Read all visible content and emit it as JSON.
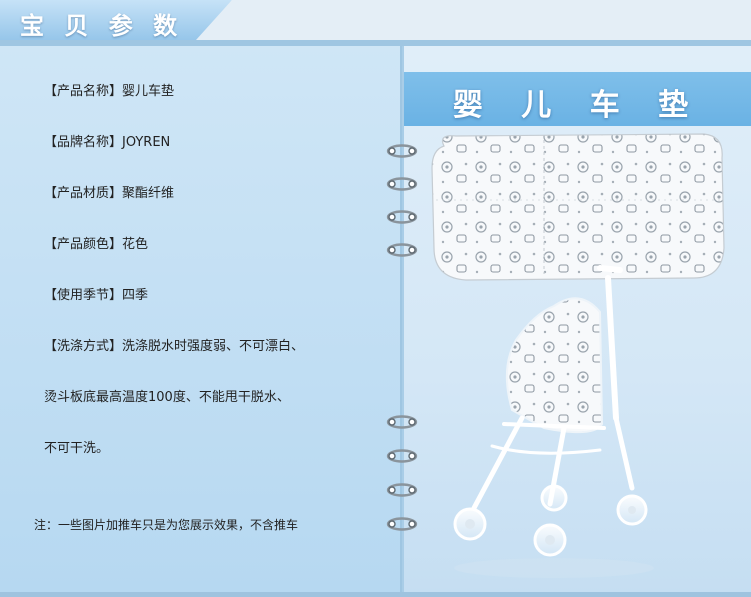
{
  "section": {
    "title": "宝 贝 参 数"
  },
  "params": [
    {
      "label": "【产品名称】婴儿车垫"
    },
    {
      "label": "【品牌名称】JOYREN"
    },
    {
      "label": "【产品材质】聚酯纤维"
    },
    {
      "label": "【产品颜色】花色"
    },
    {
      "label": "【使用季节】四季"
    },
    {
      "label": "【洗涤方式】洗涤脱水时强度弱、不可漂白、"
    },
    {
      "label": "烫斗板底最高温度100度、不能甩干脱水、"
    },
    {
      "label": "不可干洗。"
    }
  ],
  "note": "注：一些图片加推车只是为您展示效果，不含推车",
  "product": {
    "title": "婴 儿 车 垫"
  },
  "icons": [
    "binder-ring-icon",
    "seat-pad-image",
    "stroller-image"
  ],
  "colors": {
    "accent": "#6ab2e4",
    "panel": "#b6d8f1",
    "header": "#a8d2f0"
  }
}
